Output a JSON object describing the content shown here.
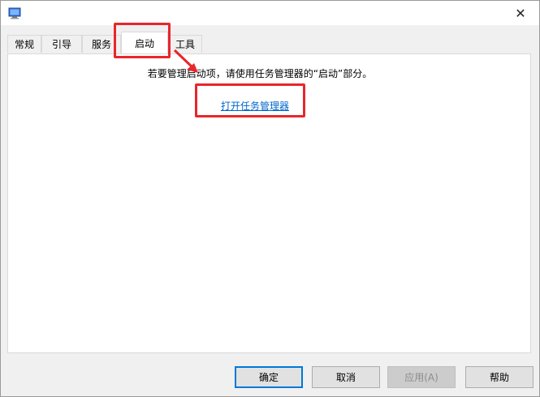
{
  "window": {
    "close_glyph": "✕"
  },
  "tabs": [
    {
      "label": "常规"
    },
    {
      "label": "引导"
    },
    {
      "label": "服务"
    },
    {
      "label": "启动"
    },
    {
      "label": "工具"
    }
  ],
  "startup": {
    "info_text": "若要管理启动项，请使用任务管理器的“启动”部分。",
    "open_task_manager_link": "打开任务管理器"
  },
  "buttons": {
    "ok": "确定",
    "cancel": "取消",
    "apply": "应用(A)",
    "help": "帮助"
  },
  "annotation": {
    "highlight_color": "#e8262b"
  }
}
